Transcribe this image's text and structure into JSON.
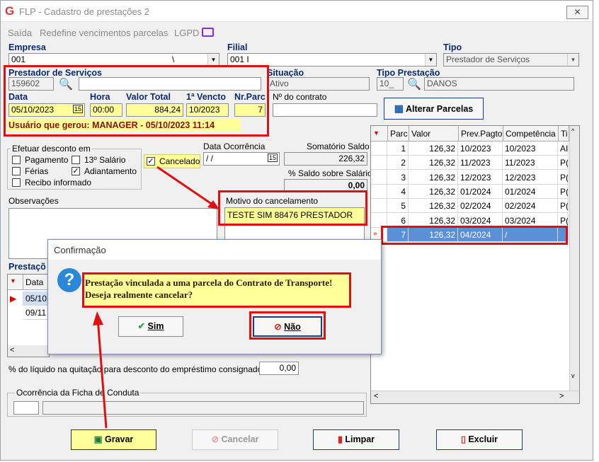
{
  "window": {
    "title": "FLP - Cadastro de prestações 2",
    "logo": "G",
    "close": "✕"
  },
  "menu": {
    "items": [
      "Saída",
      "Redefine vencimentos parcelas",
      "LGPD"
    ]
  },
  "labels": {
    "empresa": "Empresa",
    "filial": "Filial",
    "tipo": "Tipo",
    "prestador": "Prestador de Serviços",
    "situacao": "Situação",
    "tipo_prestacao": "Tipo Prestação",
    "data": "Data",
    "hora": "Hora",
    "valor_total": "Valor Total",
    "primeiro_vencto": "1ª Vencto",
    "nr_parc": "Nr.Parc",
    "nr_contrato": "Nº do contrato",
    "efetuar_desconto": "Efetuar desconto em",
    "pagamento": "Pagamento",
    "decimo_terceiro": "13º Salário",
    "ferias": "Férias",
    "adiantamento": "Adiantamento",
    "recibo": "Recibo informado",
    "cancelado": "Cancelado",
    "data_ocorrencia": "Data Ocorrência",
    "somatorio": "Somatório Saldo",
    "perc_saldo": "% Saldo sobre Salário",
    "observacoes": "Observações",
    "motivo": "Motivo do cancelamento",
    "prestacoes": "Prestaçõ",
    "perc_liquido": "% do líquido na quitação para desconto do empréstimo consignado",
    "ocorrencia_ficha": "Ocorrência da Ficha de Conduta"
  },
  "fields": {
    "empresa": "001",
    "empresa_extra": "\\",
    "filial": "001 I",
    "tipo": "Prestador de Serviços",
    "prestador_code": "159602",
    "prestador_name": "",
    "situacao": "Ativo",
    "tipo_prest_code": "10_",
    "tipo_prest_name": "DANOS",
    "data": "05/10/2023",
    "hora": "00:00",
    "valor_total": "884,24",
    "vencto": "10/2023",
    "nr_parc": "7",
    "contrato": "",
    "data_ocorrencia": " / /",
    "somatorio": "226,32",
    "perc_saldo": "0,00",
    "motivo": "TESTE SIM 88476 PRESTADOR",
    "perc_liquido": "0,00",
    "usuario": "Usuário que gerou: MANAGER - 05/10/2023 11:14"
  },
  "checks": {
    "pagamento": "",
    "decimo": "",
    "ferias": "",
    "adiantamento": "✓",
    "recibo": "",
    "cancelado": "✓"
  },
  "buttons": {
    "alterar": "Alterar Parcelas",
    "gravar": "Gravar",
    "cancelar": "Cancelar",
    "limpar": "Limpar",
    "excluir": "Excluir"
  },
  "grid": {
    "headers": [
      "Parc",
      "Valor",
      "Prev.Pagto",
      "Competência",
      "Ti"
    ],
    "rows": [
      [
        "1",
        "126,32",
        "10/2023",
        "10/2023",
        "AI"
      ],
      [
        "2",
        "126,32",
        "11/2023",
        "11/2023",
        "P("
      ],
      [
        "3",
        "126,32",
        "12/2023",
        "12/2023",
        "P("
      ],
      [
        "4",
        "126,32",
        "01/2024",
        "01/2024",
        "P("
      ],
      [
        "5",
        "126,32",
        "02/2024",
        "02/2024",
        "P("
      ],
      [
        "6",
        "126,32",
        "03/2024",
        "03/2024",
        "P("
      ],
      [
        "7",
        "126,32",
        "04/2024",
        "/",
        ""
      ]
    ]
  },
  "left_grid": {
    "header": "Data",
    "rows": [
      "05/10",
      "09/11"
    ]
  },
  "dialog": {
    "title": "Confirmação",
    "line1": "Prestação vinculada a uma parcela do Contrato de Transporte!",
    "line2": "Deseja realmente cancelar?",
    "sim": "Sim",
    "nao": "Não"
  },
  "colors": {
    "highlight_red": "#e01010",
    "field_yellow": "#ffff99",
    "label_blue": "#0b2a6e",
    "selected_row": "#5b8fd6"
  }
}
